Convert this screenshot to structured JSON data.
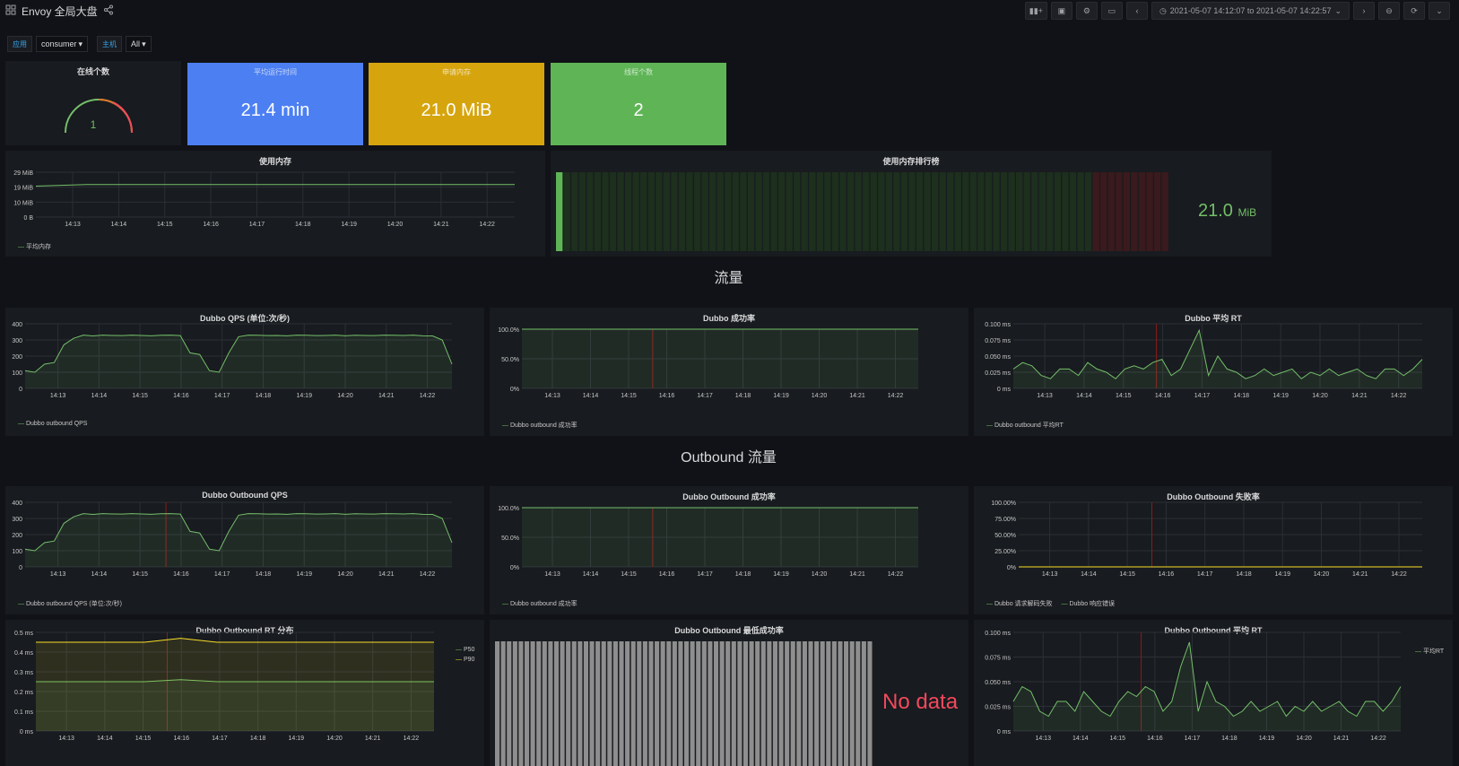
{
  "header": {
    "title": "Envoy 全局大盘",
    "time_range": "2021-05-07 14:12:07 to 2021-05-07 14:22:57"
  },
  "variables": [
    {
      "label": "应用",
      "value": "consumer"
    },
    {
      "label": "主机",
      "value": "All"
    }
  ],
  "stats": {
    "online": {
      "title": "在线个数",
      "value": "1"
    },
    "uptime": {
      "title": "平均运行时间",
      "value": "21.4 min",
      "color": "#4c7ff2"
    },
    "heap": {
      "title": "申请内存",
      "value": "21.0 MiB",
      "color": "#d6a50e"
    },
    "threads": {
      "title": "线程个数",
      "value": "2",
      "color": "#5fb556"
    }
  },
  "memory_panel": {
    "title": "使用内存",
    "legend": "平均内存"
  },
  "memory_rank": {
    "title": "使用内存排行榜",
    "value": "21.0",
    "unit": "MiB"
  },
  "rows": {
    "traffic": "流量",
    "outbound": "Outbound 流量"
  },
  "panels": {
    "qps": {
      "title": "Dubbo QPS (单位:次/秒)",
      "legend": "Dubbo outbound QPS"
    },
    "success": {
      "title": "Dubbo 成功率",
      "legend": "Dubbo outbound 成功率"
    },
    "rt": {
      "title": "Dubbo 平均 RT",
      "legend": "Dubbo outbound 平均RT"
    },
    "out_qps": {
      "title": "Dubbo Outbound QPS",
      "legend": "Dubbo outbound QPS (单位:次/秒)"
    },
    "out_success": {
      "title": "Dubbo Outbound 成功率",
      "legend": "Dubbo outbound 成功率"
    },
    "out_fail": {
      "title": "Dubbo Outbound 失败率",
      "legend1": "Dubbo 请求解码失败",
      "legend2": "Dubbo 响应错误"
    },
    "out_rt_dist": {
      "title": "Dubbo Outbound RT 分布",
      "legend1": "P50",
      "legend2": "P90"
    },
    "out_min_success": {
      "title": "Dubbo Outbound 最低成功率",
      "nodata": "No data"
    },
    "out_avg_rt": {
      "title": "Dubbo Outbound 平均 RT",
      "legend": "平均RT"
    }
  },
  "chart_data": [
    {
      "id": "memory",
      "type": "line",
      "x": [
        "14:13",
        "14:14",
        "14:15",
        "14:16",
        "14:17",
        "14:18",
        "14:19",
        "14:20",
        "14:21",
        "14:22"
      ],
      "yticks": [
        "0 B",
        "10 MiB",
        "19 MiB",
        "29 MiB"
      ],
      "ylim": [
        0,
        29
      ],
      "series": [
        {
          "name": "平均内存",
          "values": [
            20,
            20.5,
            21,
            21,
            21,
            21,
            21,
            21,
            21,
            21,
            21,
            21,
            21,
            21,
            21,
            21,
            21,
            21,
            21,
            21
          ]
        }
      ]
    },
    {
      "id": "qps",
      "type": "line",
      "x": [
        "14:13",
        "14:14",
        "14:15",
        "14:16",
        "14:17",
        "14:18",
        "14:19",
        "14:20",
        "14:21",
        "14:22"
      ],
      "yticks": [
        "0",
        "100",
        "200",
        "300",
        "400"
      ],
      "ylim": [
        0,
        400
      ],
      "series": [
        {
          "name": "Dubbo outbound QPS",
          "values": [
            110,
            100,
            150,
            160,
            270,
            310,
            330,
            325,
            330,
            328,
            327,
            330,
            328,
            326,
            329,
            330,
            327,
            220,
            210,
            110,
            100,
            220,
            320,
            330,
            329,
            327,
            328,
            326,
            330,
            329,
            327,
            328,
            330,
            326,
            329,
            328,
            327,
            330,
            329,
            328,
            330,
            326,
            325,
            300,
            150
          ]
        }
      ]
    },
    {
      "id": "success",
      "type": "line",
      "x": [
        "14:13",
        "14:14",
        "14:15",
        "14:16",
        "14:17",
        "14:18",
        "14:19",
        "14:20",
        "14:21",
        "14:22"
      ],
      "yticks": [
        "0%",
        "50.0%",
        "100.0%"
      ],
      "ylim": [
        0,
        100
      ],
      "series": [
        {
          "name": "Dubbo outbound 成功率",
          "values": [
            100,
            100,
            100,
            100,
            100,
            100,
            100,
            100,
            100,
            100
          ]
        }
      ]
    },
    {
      "id": "rt",
      "type": "line",
      "x": [
        "14:13",
        "14:14",
        "14:15",
        "14:16",
        "14:17",
        "14:18",
        "14:19",
        "14:20",
        "14:21",
        "14:22"
      ],
      "yticks": [
        "0 ms",
        "0.025 ms",
        "0.050 ms",
        "0.075 ms",
        "0.100 ms"
      ],
      "ylim": [
        0,
        0.1
      ],
      "series": [
        {
          "name": "Dubbo outbound 平均RT",
          "values": [
            0.03,
            0.04,
            0.035,
            0.02,
            0.015,
            0.03,
            0.03,
            0.02,
            0.04,
            0.03,
            0.025,
            0.015,
            0.03,
            0.035,
            0.03,
            0.04,
            0.045,
            0.02,
            0.03,
            0.06,
            0.09,
            0.02,
            0.05,
            0.03,
            0.025,
            0.015,
            0.02,
            0.03,
            0.02,
            0.025,
            0.03,
            0.015,
            0.025,
            0.02,
            0.03,
            0.02,
            0.025,
            0.03,
            0.02,
            0.015,
            0.03,
            0.03,
            0.02,
            0.03,
            0.045
          ]
        }
      ]
    },
    {
      "id": "out_qps",
      "type": "line",
      "x": [
        "14:13",
        "14:14",
        "14:15",
        "14:16",
        "14:17",
        "14:18",
        "14:19",
        "14:20",
        "14:21",
        "14:22"
      ],
      "yticks": [
        "0",
        "100",
        "200",
        "300",
        "400"
      ],
      "ylim": [
        0,
        400
      ],
      "series": [
        {
          "name": "Dubbo outbound QPS (单位:次/秒)",
          "values": [
            110,
            100,
            150,
            160,
            270,
            310,
            330,
            325,
            330,
            328,
            327,
            330,
            328,
            326,
            329,
            330,
            327,
            220,
            210,
            110,
            100,
            220,
            320,
            330,
            329,
            327,
            328,
            326,
            330,
            329,
            327,
            328,
            330,
            326,
            329,
            328,
            327,
            330,
            329,
            328,
            330,
            326,
            325,
            300,
            150
          ]
        }
      ]
    },
    {
      "id": "out_success",
      "type": "line",
      "x": [
        "14:13",
        "14:14",
        "14:15",
        "14:16",
        "14:17",
        "14:18",
        "14:19",
        "14:20",
        "14:21",
        "14:22"
      ],
      "yticks": [
        "0%",
        "50.0%",
        "100.0%"
      ],
      "ylim": [
        0,
        100
      ],
      "series": [
        {
          "name": "Dubbo outbound 成功率",
          "values": [
            100,
            100,
            100,
            100,
            100,
            100,
            100,
            100,
            100,
            100
          ]
        }
      ]
    },
    {
      "id": "out_fail",
      "type": "line",
      "x": [
        "14:13",
        "14:14",
        "14:15",
        "14:16",
        "14:17",
        "14:18",
        "14:19",
        "14:20",
        "14:21",
        "14:22"
      ],
      "yticks": [
        "0%",
        "25.00%",
        "50.00%",
        "75.00%",
        "100.00%"
      ],
      "ylim": [
        0,
        100
      ],
      "series": [
        {
          "name": "Dubbo 请求解码失败",
          "values": [
            0,
            0,
            0,
            0,
            0,
            0,
            0,
            0,
            0,
            0
          ]
        },
        {
          "name": "Dubbo 响应错误",
          "values": [
            0,
            0,
            0,
            0,
            0,
            0,
            0,
            0,
            0,
            0
          ]
        }
      ]
    },
    {
      "id": "out_rt_dist",
      "type": "area",
      "x": [
        "14:13",
        "14:14",
        "14:15",
        "14:16",
        "14:17",
        "14:18",
        "14:19",
        "14:20",
        "14:21",
        "14:22"
      ],
      "yticks": [
        "0 ms",
        "0.1 ms",
        "0.2 ms",
        "0.3 ms",
        "0.4 ms",
        "0.5 ms"
      ],
      "ylim": [
        0,
        0.5
      ],
      "series": [
        {
          "name": "P50",
          "values": [
            0.25,
            0.25,
            0.25,
            0.25,
            0.26,
            0.25,
            0.25,
            0.25,
            0.25,
            0.25,
            0.25,
            0.25
          ]
        },
        {
          "name": "P90",
          "values": [
            0.45,
            0.45,
            0.45,
            0.45,
            0.47,
            0.45,
            0.45,
            0.45,
            0.45,
            0.45,
            0.45,
            0.45
          ]
        }
      ]
    },
    {
      "id": "out_avg_rt",
      "type": "line",
      "x": [
        "14:13",
        "14:14",
        "14:15",
        "14:16",
        "14:17",
        "14:18",
        "14:19",
        "14:20",
        "14:21",
        "14:22"
      ],
      "yticks": [
        "0 ms",
        "0.025 ms",
        "0.050 ms",
        "0.075 ms",
        "0.100 ms"
      ],
      "ylim": [
        0,
        0.1
      ],
      "series": [
        {
          "name": "平均RT",
          "values": [
            0.03,
            0.045,
            0.04,
            0.02,
            0.015,
            0.03,
            0.03,
            0.02,
            0.04,
            0.03,
            0.02,
            0.015,
            0.03,
            0.04,
            0.035,
            0.045,
            0.04,
            0.02,
            0.03,
            0.065,
            0.09,
            0.02,
            0.05,
            0.03,
            0.025,
            0.015,
            0.02,
            0.03,
            0.02,
            0.025,
            0.03,
            0.015,
            0.025,
            0.02,
            0.03,
            0.02,
            0.025,
            0.03,
            0.02,
            0.015,
            0.03,
            0.03,
            0.02,
            0.03,
            0.045
          ]
        }
      ]
    }
  ]
}
